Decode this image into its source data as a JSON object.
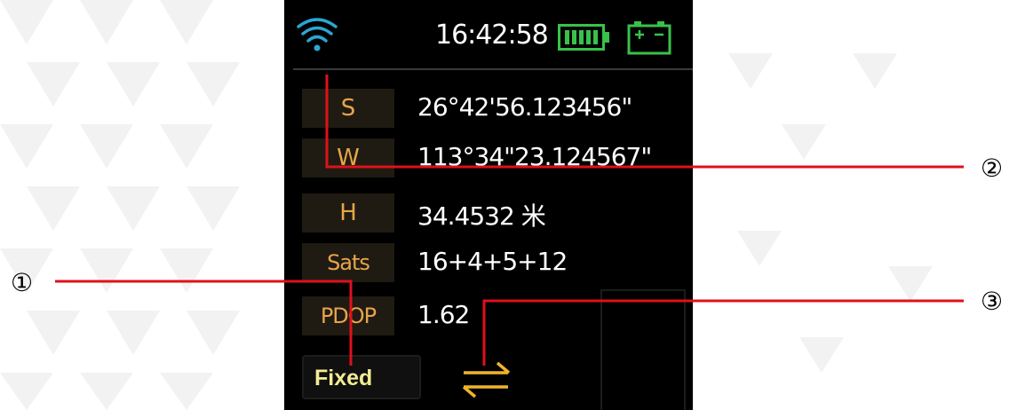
{
  "status_bar": {
    "time": "16:42:58",
    "wifi_icon": "wifi-signal-icon",
    "battery_icon": "battery-full-icon",
    "power_icon": "external-power-icon",
    "colors": {
      "wifi": "#2aa6d6",
      "battery": "#38c24a",
      "power": "#38c24a"
    }
  },
  "readings": [
    {
      "label": "S",
      "value": "26°42'56.123456\""
    },
    {
      "label": "W",
      "value": "113°34\"23.124567\""
    },
    {
      "label": "H",
      "value": "34.4532 米"
    },
    {
      "label": "Sats",
      "value": "16+4+5+12"
    },
    {
      "label": "PDOP",
      "value": "1.62"
    }
  ],
  "fix_status": "Fixed",
  "transfer_icon": "data-transfer-arrows-icon",
  "annotations": {
    "marker_1": "①",
    "marker_2": "②",
    "marker_3": "③",
    "line_color": "#e0101b"
  },
  "colors": {
    "label_text": "#e7a54b",
    "label_bg": "#1f1b12",
    "fix_text": "#f3ec94",
    "transfer_icon": "#f0b429"
  }
}
